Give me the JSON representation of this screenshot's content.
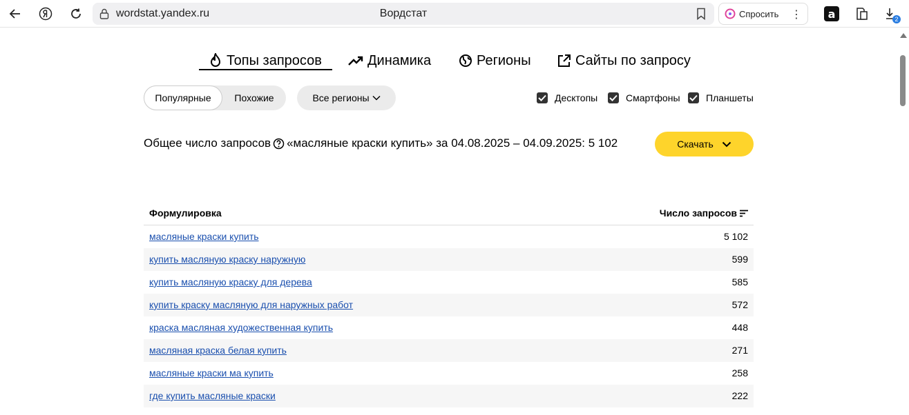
{
  "browser": {
    "url": "wordstat.yandex.ru",
    "page_title": "Вордстат",
    "ask_label": "Спросить",
    "downloads_badge": "2"
  },
  "tabs": [
    {
      "label": "Топы запросов",
      "icon": "fire-icon",
      "active": true
    },
    {
      "label": "Динамика",
      "icon": "trend-icon"
    },
    {
      "label": "Регионы",
      "icon": "globe-icon"
    },
    {
      "label": "Сайты по запросу",
      "icon": "external-link-icon"
    }
  ],
  "filters": {
    "popular": "Популярные",
    "similar": "Похожие",
    "regions": "Все регионы",
    "devices": [
      {
        "label": "Десктопы",
        "checked": true
      },
      {
        "label": "Смартфоны",
        "checked": true
      },
      {
        "label": "Планшеты",
        "checked": true
      }
    ]
  },
  "summary": {
    "prefix": "Общее число запросов",
    "text": "«масляные краски купить» за 04.08.2025 – 04.09.2025: 5 102",
    "download_label": "Скачать"
  },
  "table": {
    "col_phrase": "Формулировка",
    "col_count": "Число запросов",
    "rows": [
      {
        "phrase": "масляные краски купить",
        "count": "5 102"
      },
      {
        "phrase": "купить масляную краску наружную",
        "count": "599"
      },
      {
        "phrase": "купить масляную краску для дерева",
        "count": "585"
      },
      {
        "phrase": "купить краску масляную для наружных работ",
        "count": "572"
      },
      {
        "phrase": "краска масляная художественная купить",
        "count": "448"
      },
      {
        "phrase": "масляная краска белая купить",
        "count": "271"
      },
      {
        "phrase": "масляные краски ма купить",
        "count": "258"
      },
      {
        "phrase": "где купить масляные краски",
        "count": "222"
      }
    ]
  },
  "colors": {
    "accent": "#fed42b",
    "link": "#1a4fae"
  }
}
